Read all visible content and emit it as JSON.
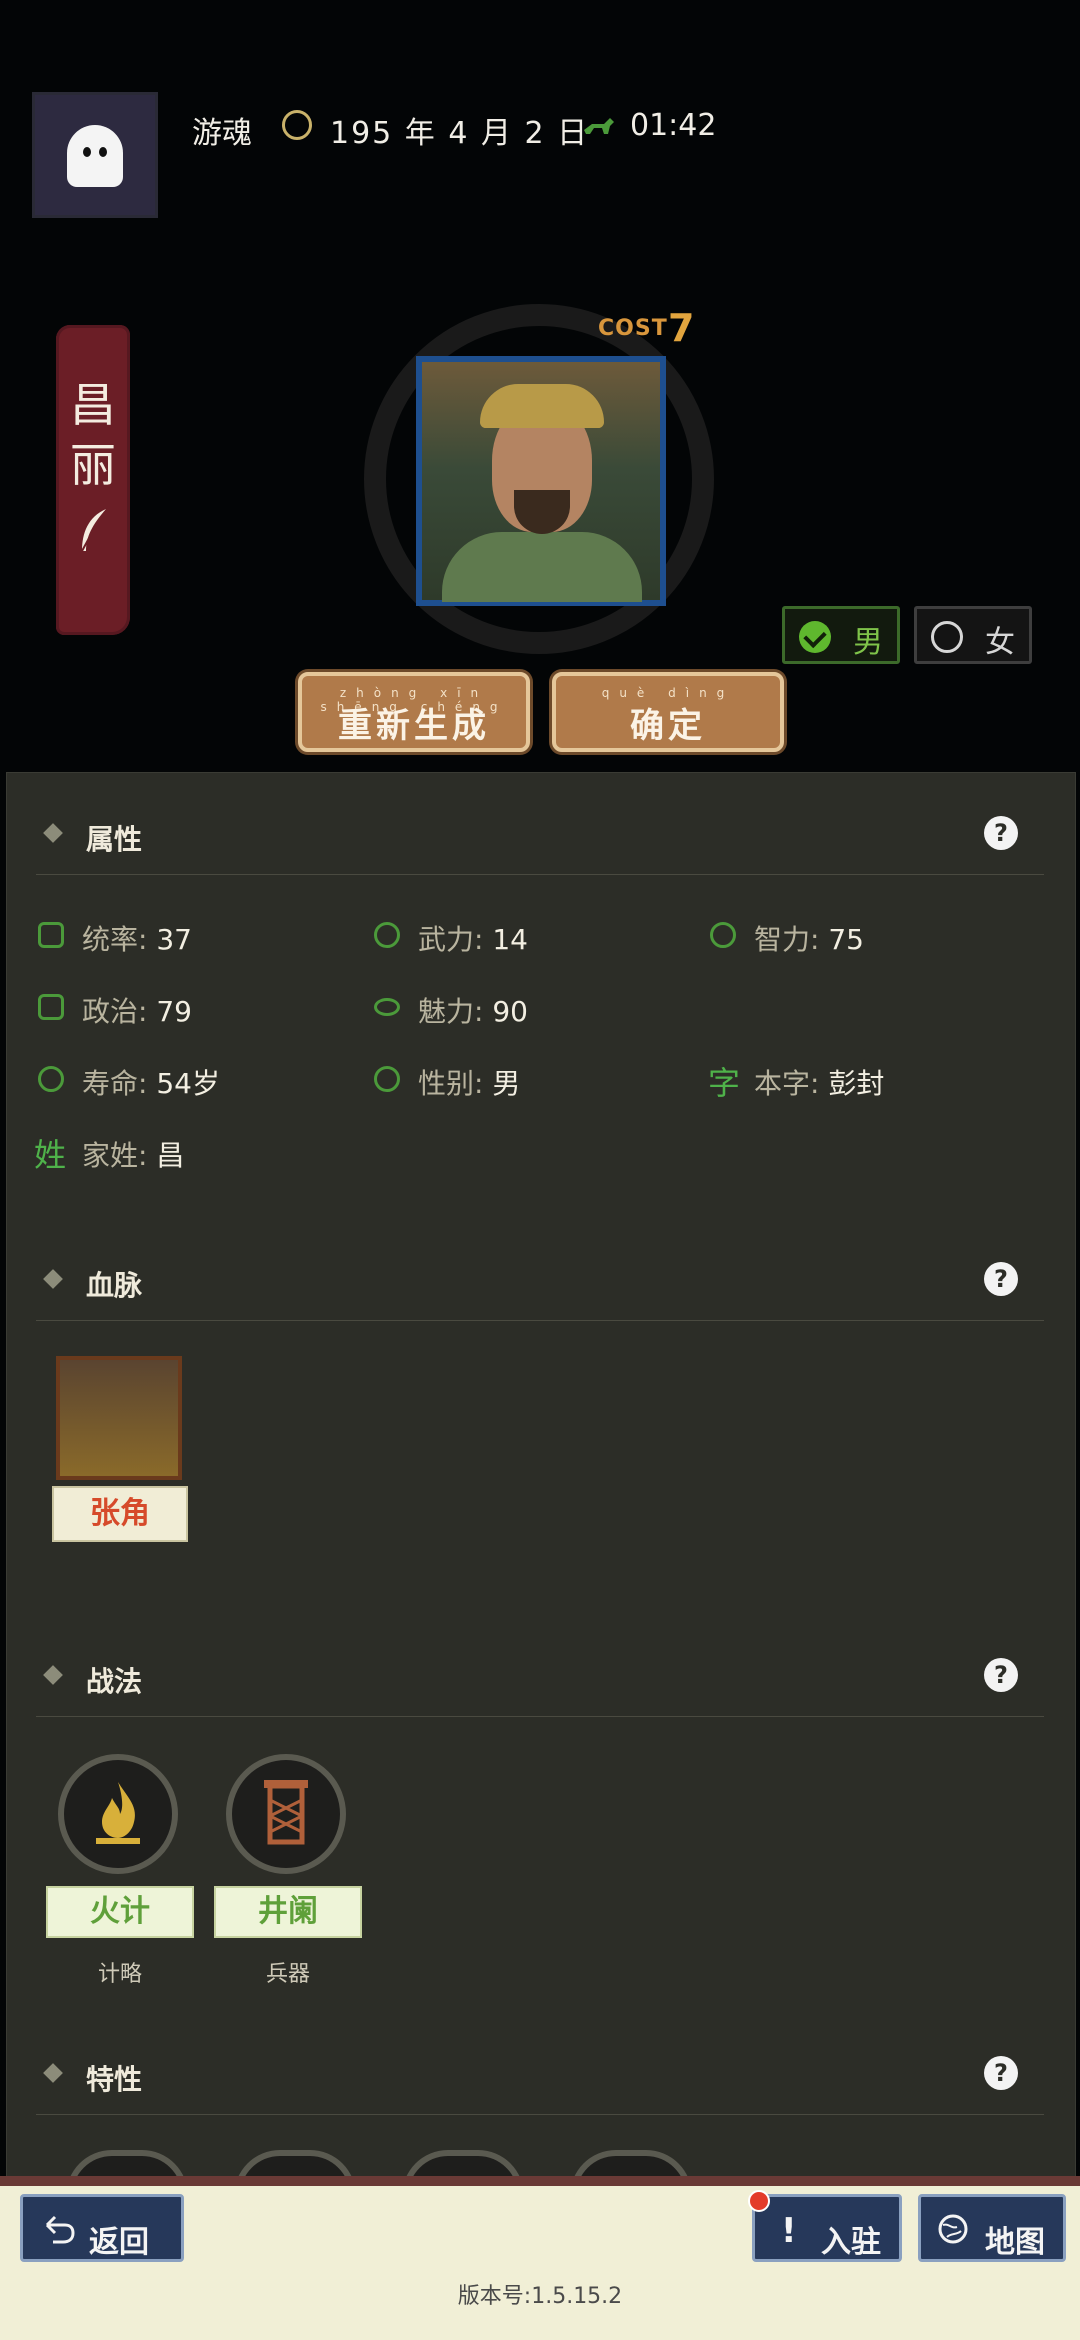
{
  "header": {
    "username": "游魂",
    "date": "195 年 4 月 2 日",
    "time": "01:42"
  },
  "character": {
    "name_line1": "昌",
    "name_line2": "丽",
    "cost_label": "COST",
    "cost_value": "7",
    "gender_options": [
      {
        "label": "男",
        "selected": true
      },
      {
        "label": "女",
        "selected": false
      }
    ]
  },
  "actions": {
    "regenerate": "重新生成",
    "regenerate_ruby": "zhòng xīn shēng chéng",
    "confirm": "确定",
    "confirm_ruby": "què dìng"
  },
  "sections": {
    "attributes": {
      "title": "属性",
      "stats": [
        {
          "label": "统率",
          "value": "37"
        },
        {
          "label": "武力",
          "value": "14"
        },
        {
          "label": "智力",
          "value": "75"
        },
        {
          "label": "政治",
          "value": "79"
        },
        {
          "label": "魅力",
          "value": "90"
        },
        {
          "label": "寿命",
          "value": "54岁"
        },
        {
          "label": "性别",
          "value": "男"
        },
        {
          "label": "本字",
          "value": "彭封"
        },
        {
          "label": "家姓",
          "value": "昌"
        }
      ],
      "char_icon_zi": "字",
      "char_icon_xing": "姓"
    },
    "lineage": {
      "title": "血脉",
      "ancestor_name": "张角"
    },
    "tactics": {
      "title": "战法",
      "items": [
        {
          "name": "火计",
          "type": "计略"
        },
        {
          "name": "井阑",
          "type": "兵器"
        }
      ]
    },
    "traits": {
      "title": "特性"
    }
  },
  "bottom": {
    "back": "返回",
    "enter": "入驻",
    "map": "地图",
    "version": "版本号:1.5.15.2"
  }
}
